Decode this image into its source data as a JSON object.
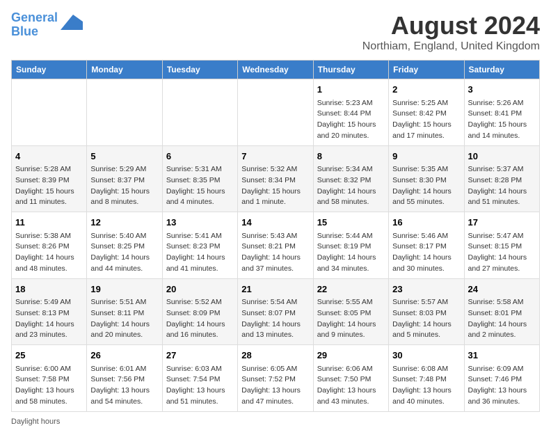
{
  "header": {
    "logo_line1": "General",
    "logo_line2": "Blue",
    "main_title": "August 2024",
    "subtitle": "Northiam, England, United Kingdom"
  },
  "columns": [
    "Sunday",
    "Monday",
    "Tuesday",
    "Wednesday",
    "Thursday",
    "Friday",
    "Saturday"
  ],
  "weeks": [
    [
      {
        "day": "",
        "detail": ""
      },
      {
        "day": "",
        "detail": ""
      },
      {
        "day": "",
        "detail": ""
      },
      {
        "day": "",
        "detail": ""
      },
      {
        "day": "1",
        "detail": "Sunrise: 5:23 AM\nSunset: 8:44 PM\nDaylight: 15 hours\nand 20 minutes."
      },
      {
        "day": "2",
        "detail": "Sunrise: 5:25 AM\nSunset: 8:42 PM\nDaylight: 15 hours\nand 17 minutes."
      },
      {
        "day": "3",
        "detail": "Sunrise: 5:26 AM\nSunset: 8:41 PM\nDaylight: 15 hours\nand 14 minutes."
      }
    ],
    [
      {
        "day": "4",
        "detail": "Sunrise: 5:28 AM\nSunset: 8:39 PM\nDaylight: 15 hours\nand 11 minutes."
      },
      {
        "day": "5",
        "detail": "Sunrise: 5:29 AM\nSunset: 8:37 PM\nDaylight: 15 hours\nand 8 minutes."
      },
      {
        "day": "6",
        "detail": "Sunrise: 5:31 AM\nSunset: 8:35 PM\nDaylight: 15 hours\nand 4 minutes."
      },
      {
        "day": "7",
        "detail": "Sunrise: 5:32 AM\nSunset: 8:34 PM\nDaylight: 15 hours\nand 1 minute."
      },
      {
        "day": "8",
        "detail": "Sunrise: 5:34 AM\nSunset: 8:32 PM\nDaylight: 14 hours\nand 58 minutes."
      },
      {
        "day": "9",
        "detail": "Sunrise: 5:35 AM\nSunset: 8:30 PM\nDaylight: 14 hours\nand 55 minutes."
      },
      {
        "day": "10",
        "detail": "Sunrise: 5:37 AM\nSunset: 8:28 PM\nDaylight: 14 hours\nand 51 minutes."
      }
    ],
    [
      {
        "day": "11",
        "detail": "Sunrise: 5:38 AM\nSunset: 8:26 PM\nDaylight: 14 hours\nand 48 minutes."
      },
      {
        "day": "12",
        "detail": "Sunrise: 5:40 AM\nSunset: 8:25 PM\nDaylight: 14 hours\nand 44 minutes."
      },
      {
        "day": "13",
        "detail": "Sunrise: 5:41 AM\nSunset: 8:23 PM\nDaylight: 14 hours\nand 41 minutes."
      },
      {
        "day": "14",
        "detail": "Sunrise: 5:43 AM\nSunset: 8:21 PM\nDaylight: 14 hours\nand 37 minutes."
      },
      {
        "day": "15",
        "detail": "Sunrise: 5:44 AM\nSunset: 8:19 PM\nDaylight: 14 hours\nand 34 minutes."
      },
      {
        "day": "16",
        "detail": "Sunrise: 5:46 AM\nSunset: 8:17 PM\nDaylight: 14 hours\nand 30 minutes."
      },
      {
        "day": "17",
        "detail": "Sunrise: 5:47 AM\nSunset: 8:15 PM\nDaylight: 14 hours\nand 27 minutes."
      }
    ],
    [
      {
        "day": "18",
        "detail": "Sunrise: 5:49 AM\nSunset: 8:13 PM\nDaylight: 14 hours\nand 23 minutes."
      },
      {
        "day": "19",
        "detail": "Sunrise: 5:51 AM\nSunset: 8:11 PM\nDaylight: 14 hours\nand 20 minutes."
      },
      {
        "day": "20",
        "detail": "Sunrise: 5:52 AM\nSunset: 8:09 PM\nDaylight: 14 hours\nand 16 minutes."
      },
      {
        "day": "21",
        "detail": "Sunrise: 5:54 AM\nSunset: 8:07 PM\nDaylight: 14 hours\nand 13 minutes."
      },
      {
        "day": "22",
        "detail": "Sunrise: 5:55 AM\nSunset: 8:05 PM\nDaylight: 14 hours\nand 9 minutes."
      },
      {
        "day": "23",
        "detail": "Sunrise: 5:57 AM\nSunset: 8:03 PM\nDaylight: 14 hours\nand 5 minutes."
      },
      {
        "day": "24",
        "detail": "Sunrise: 5:58 AM\nSunset: 8:01 PM\nDaylight: 14 hours\nand 2 minutes."
      }
    ],
    [
      {
        "day": "25",
        "detail": "Sunrise: 6:00 AM\nSunset: 7:58 PM\nDaylight: 13 hours\nand 58 minutes."
      },
      {
        "day": "26",
        "detail": "Sunrise: 6:01 AM\nSunset: 7:56 PM\nDaylight: 13 hours\nand 54 minutes."
      },
      {
        "day": "27",
        "detail": "Sunrise: 6:03 AM\nSunset: 7:54 PM\nDaylight: 13 hours\nand 51 minutes."
      },
      {
        "day": "28",
        "detail": "Sunrise: 6:05 AM\nSunset: 7:52 PM\nDaylight: 13 hours\nand 47 minutes."
      },
      {
        "day": "29",
        "detail": "Sunrise: 6:06 AM\nSunset: 7:50 PM\nDaylight: 13 hours\nand 43 minutes."
      },
      {
        "day": "30",
        "detail": "Sunrise: 6:08 AM\nSunset: 7:48 PM\nDaylight: 13 hours\nand 40 minutes."
      },
      {
        "day": "31",
        "detail": "Sunrise: 6:09 AM\nSunset: 7:46 PM\nDaylight: 13 hours\nand 36 minutes."
      }
    ]
  ],
  "footer": {
    "daylight_label": "Daylight hours"
  }
}
